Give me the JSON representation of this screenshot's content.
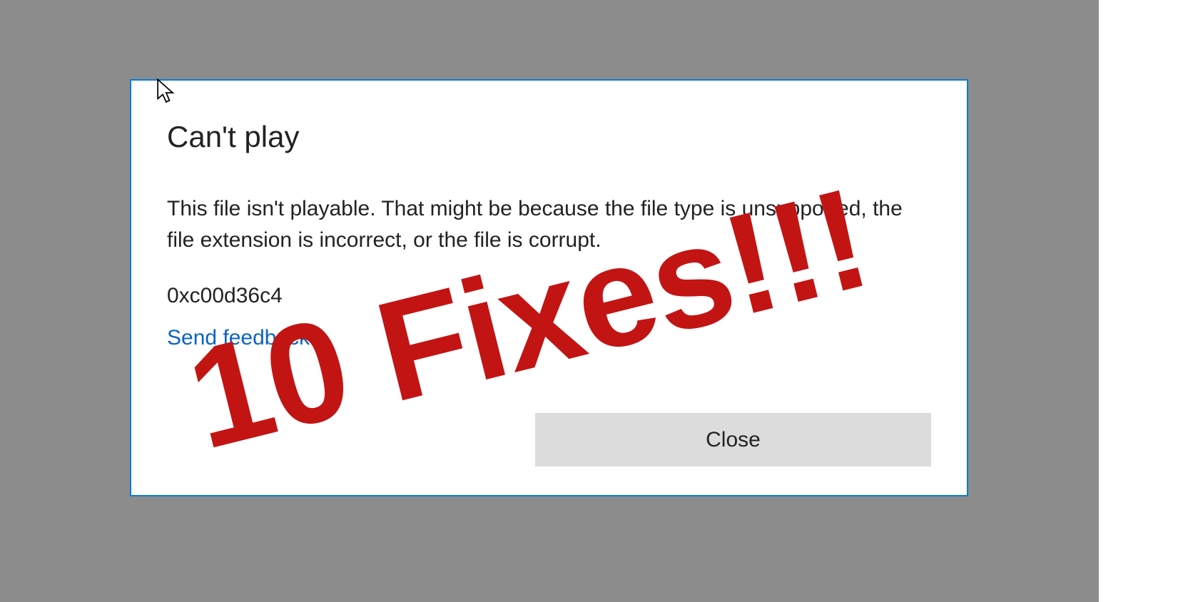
{
  "dialog": {
    "title": "Can't play",
    "body": "This file isn't playable. That might be because the file type is unsupported, the file extension is incorrect, or the file is corrupt.",
    "error_code": "0xc00d36c4",
    "feedback_link": "Send feedback",
    "close_button": "Close"
  },
  "overlay": {
    "text": "10 Fixes!!!"
  }
}
